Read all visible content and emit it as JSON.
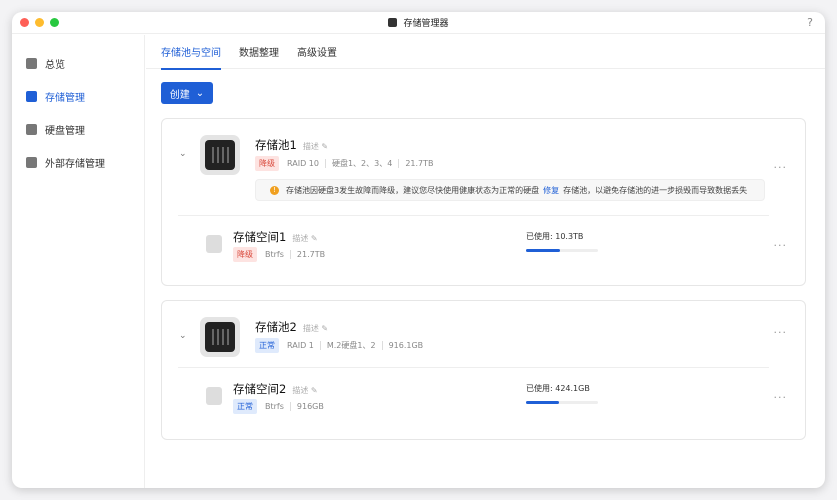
{
  "window": {
    "title": "存储管理器",
    "help": "?"
  },
  "sidebar": {
    "items": [
      {
        "label": "总览"
      },
      {
        "label": "存储管理",
        "active": true
      },
      {
        "label": "硬盘管理"
      },
      {
        "label": "外部存储管理"
      }
    ]
  },
  "tabs": [
    {
      "label": "存储池与空间",
      "active": true
    },
    {
      "label": "数据整理"
    },
    {
      "label": "高级设置"
    }
  ],
  "create_label": "创建",
  "desc_label": "描述",
  "more": "···",
  "colors": {
    "accent": "#1f5fd6",
    "degraded": "#d94a3d",
    "warning": "#f0a020"
  },
  "pools": [
    {
      "name": "存储池1",
      "status": "降级",
      "raid": "RAID 10",
      "disks": "硬盘1、2、3、4",
      "size": "21.7TB",
      "warning": {
        "before": "存储池因硬盘3发生故障而降级，建议您尽快使用健康状态为正常的硬盘",
        "link": "修复",
        "after": "存储池，以避免存储池的进一步损毁而导致数据丢失"
      },
      "volume": {
        "name": "存储空间1",
        "status": "降级",
        "fs": "Btrfs",
        "size": "21.7TB",
        "used": "已使用: 10.3TB",
        "usage_pct": 47
      }
    },
    {
      "name": "存储池2",
      "status": "正常",
      "raid": "RAID 1",
      "disks": "M.2硬盘1、2",
      "size": "916.1GB",
      "volume": {
        "name": "存储空间2",
        "status": "正常",
        "fs": "Btrfs",
        "size": "916GB",
        "used": "已使用: 424.1GB",
        "usage_pct": 46
      }
    }
  ]
}
